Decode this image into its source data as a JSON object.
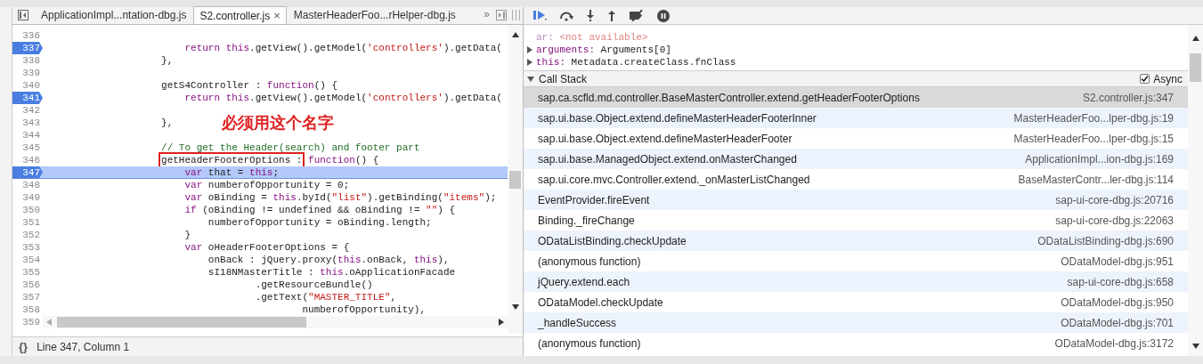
{
  "editor": {
    "tabs": [
      {
        "label": "ApplicationImpl...ntation-dbg.js",
        "selected": false
      },
      {
        "label": "S2.controller.js",
        "selected": true,
        "close": "×"
      },
      {
        "label": "MasterHeaderFoo...rHelper-dbg.js",
        "selected": false
      }
    ],
    "more": "»",
    "lines": [
      {
        "number": "336",
        "breakpoint": false,
        "current": false
      },
      {
        "number": "337",
        "breakpoint": true,
        "current": false,
        "tokens": [
          {
            "kind": "keyword",
            "text": "                        return"
          },
          {
            "kind": "keyword",
            "text": " this"
          },
          {
            "kind": "plain",
            "text": ".getView().getModel("
          },
          {
            "kind": "string",
            "text": "'controllers'"
          },
          {
            "kind": "plain",
            "text": ").getData("
          }
        ]
      },
      {
        "number": "338",
        "breakpoint": false,
        "current": false,
        "tokens": [
          {
            "kind": "plain",
            "text": "                    },"
          }
        ]
      },
      {
        "number": "339",
        "breakpoint": false,
        "current": false
      },
      {
        "number": "340",
        "breakpoint": false,
        "current": false,
        "tokens": [
          {
            "kind": "plain",
            "text": "                    getS4Controller : "
          },
          {
            "kind": "keyword",
            "text": "function"
          },
          {
            "kind": "plain",
            "text": "() {"
          }
        ]
      },
      {
        "number": "341",
        "breakpoint": true,
        "current": false,
        "tokens": [
          {
            "kind": "keyword",
            "text": "                        return"
          },
          {
            "kind": "keyword",
            "text": " this"
          },
          {
            "kind": "plain",
            "text": ".getView().getModel("
          },
          {
            "kind": "string",
            "text": "'controllers'"
          },
          {
            "kind": "plain",
            "text": ").getData("
          }
        ]
      },
      {
        "number": "342",
        "breakpoint": false,
        "current": false
      },
      {
        "number": "343",
        "breakpoint": false,
        "current": false,
        "tokens": [
          {
            "kind": "plain",
            "text": "                    },"
          }
        ]
      },
      {
        "number": "344",
        "breakpoint": false,
        "current": false
      },
      {
        "number": "345",
        "breakpoint": false,
        "current": false,
        "tokens": [
          {
            "kind": "comment",
            "text": "                    // To get the Header(search) and footer part"
          }
        ]
      },
      {
        "number": "346",
        "breakpoint": false,
        "current": false,
        "boxed": "                    getHeaderFooterOptions :",
        "tokens": [
          {
            "kind": "keyword",
            "text": " function"
          },
          {
            "kind": "plain",
            "text": "() {"
          }
        ]
      },
      {
        "number": "347",
        "breakpoint": true,
        "current": true,
        "tokens": [
          {
            "kind": "keyword",
            "text": "                        var"
          },
          {
            "kind": "plain",
            "text": " that = "
          },
          {
            "kind": "keyword",
            "text": "this"
          },
          {
            "kind": "plain",
            "text": ";"
          }
        ]
      },
      {
        "number": "348",
        "breakpoint": false,
        "current": false,
        "tokens": [
          {
            "kind": "keyword",
            "text": "                        var"
          },
          {
            "kind": "plain",
            "text": " numberofOpportunity = 0;"
          }
        ]
      },
      {
        "number": "349",
        "breakpoint": false,
        "current": false,
        "tokens": [
          {
            "kind": "keyword",
            "text": "                        var"
          },
          {
            "kind": "plain",
            "text": " oBinding = "
          },
          {
            "kind": "keyword",
            "text": "this"
          },
          {
            "kind": "plain",
            "text": ".byId("
          },
          {
            "kind": "string",
            "text": "\"list\""
          },
          {
            "kind": "plain",
            "text": ").getBinding("
          },
          {
            "kind": "string",
            "text": "\"items\""
          },
          {
            "kind": "plain",
            "text": ");"
          }
        ]
      },
      {
        "number": "350",
        "breakpoint": false,
        "current": false,
        "tokens": [
          {
            "kind": "keyword",
            "text": "                        if"
          },
          {
            "kind": "plain",
            "text": " (oBinding != undefined && oBinding != "
          },
          {
            "kind": "string",
            "text": "\"\""
          },
          {
            "kind": "plain",
            "text": ") {"
          }
        ]
      },
      {
        "number": "351",
        "breakpoint": false,
        "current": false,
        "tokens": [
          {
            "kind": "plain",
            "text": "                            numberofOpportunity = oBinding.length;"
          }
        ]
      },
      {
        "number": "352",
        "breakpoint": false,
        "current": false,
        "tokens": [
          {
            "kind": "plain",
            "text": "                        }"
          }
        ]
      },
      {
        "number": "353",
        "breakpoint": false,
        "current": false,
        "tokens": [
          {
            "kind": "keyword",
            "text": "                        var"
          },
          {
            "kind": "plain",
            "text": " oHeaderFooterOptions = {"
          }
        ]
      },
      {
        "number": "354",
        "breakpoint": false,
        "current": false,
        "tokens": [
          {
            "kind": "plain",
            "text": "                            onBack : jQuery.proxy("
          },
          {
            "kind": "keyword",
            "text": "this"
          },
          {
            "kind": "plain",
            "text": ".onBack, "
          },
          {
            "kind": "keyword",
            "text": "this"
          },
          {
            "kind": "plain",
            "text": "),"
          }
        ]
      },
      {
        "number": "355",
        "breakpoint": false,
        "current": false,
        "tokens": [
          {
            "kind": "plain",
            "text": "                            sI18NMasterTitle : "
          },
          {
            "kind": "keyword",
            "text": "this"
          },
          {
            "kind": "plain",
            "text": ".oApplicationFacade"
          }
        ]
      },
      {
        "number": "356",
        "breakpoint": false,
        "current": false,
        "tokens": [
          {
            "kind": "plain",
            "text": "                                    .getResourceBundle()"
          }
        ]
      },
      {
        "number": "357",
        "breakpoint": false,
        "current": false,
        "tokens": [
          {
            "kind": "plain",
            "text": "                                    .getText("
          },
          {
            "kind": "string",
            "text": "\"MASTER_TITLE\""
          },
          {
            "kind": "plain",
            "text": ","
          }
        ]
      },
      {
        "number": "358",
        "breakpoint": false,
        "current": false,
        "tokens": [
          {
            "kind": "plain",
            "text": "                                            numberofOpportunity),"
          }
        ]
      }
    ],
    "last_line_number": "359",
    "annotation": "必须用这个名字",
    "format_button": "{}",
    "status": "Line 347, Column 1"
  },
  "debugger": {
    "scope": [
      {
        "expandable": false,
        "unavailable": true,
        "key": "ar:",
        "value": "<not available>"
      },
      {
        "expandable": true,
        "unavailable": false,
        "key": "arguments:",
        "value": "Arguments[0]"
      },
      {
        "expandable": true,
        "unavailable": false,
        "key": "this:",
        "value": "Metadata.createClass.fnClass"
      }
    ],
    "call_stack": {
      "title": "Call Stack",
      "async_label": "Async",
      "async": true,
      "frames": [
        {
          "function": "sap.ca.scfld.md.controller.BaseMasterController.extend.getHeaderFooterOptions",
          "location": "S2.controller.js:347",
          "selected": true
        },
        {
          "function": "sap.ui.base.Object.extend.defineMasterHeaderFooterInner",
          "location": "MasterHeaderFoo...lper-dbg.js:19",
          "selected": false
        },
        {
          "function": "sap.ui.base.Object.extend.defineMasterHeaderFooter",
          "location": "MasterHeaderFoo...lper-dbg.js:15",
          "selected": false
        },
        {
          "function": "sap.ui.base.ManagedObject.extend.onMasterChanged",
          "location": "ApplicationImpl...ion-dbg.js:169",
          "selected": false
        },
        {
          "function": "sap.ui.core.mvc.Controller.extend._onMasterListChanged",
          "location": "BaseMasterContr...ler-dbg.js:114",
          "selected": false
        },
        {
          "function": "EventProvider.fireEvent",
          "location": "sap-ui-core-dbg.js:20716",
          "selected": false
        },
        {
          "function": "Binding._fireChange",
          "location": "sap-ui-core-dbg.js:22063",
          "selected": false
        },
        {
          "function": "ODataListBinding.checkUpdate",
          "location": "ODataListBinding-dbg.js:690",
          "selected": false
        },
        {
          "function": "(anonymous function)",
          "location": "ODataModel-dbg.js:951",
          "selected": false
        },
        {
          "function": "jQuery.extend.each",
          "location": "sap-ui-core-dbg.js:658",
          "selected": false
        },
        {
          "function": "ODataModel.checkUpdate",
          "location": "ODataModel-dbg.js:950",
          "selected": false
        },
        {
          "function": "_handleSuccess",
          "location": "ODataModel-dbg.js:701",
          "selected": false
        },
        {
          "function": "(anonymous function)",
          "location": "ODataModel-dbg.js:3172",
          "selected": false
        }
      ]
    }
  }
}
